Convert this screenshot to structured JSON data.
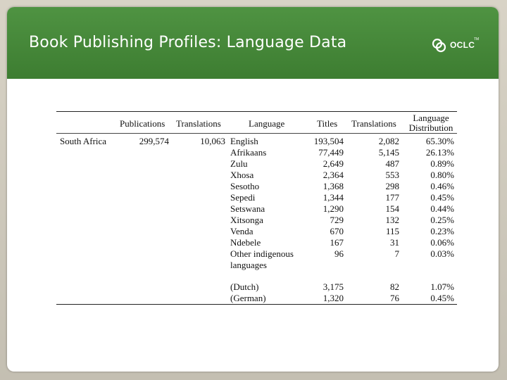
{
  "slide": {
    "title": "Book Publishing Profiles: Language Data",
    "logo": {
      "text": "OCLC",
      "tm": "TM",
      "icon": "oclc-circle-logo"
    }
  },
  "table": {
    "headers": {
      "publications": "Publications",
      "translations": "Translations",
      "language": "Language",
      "titles": "Titles",
      "lang_translations": "Translations",
      "distribution_line1": "Language",
      "distribution_line2": "Distribution"
    },
    "country": "South Africa",
    "publications": "299,574",
    "translations": "10,063",
    "rows": [
      {
        "language": "English",
        "titles": "193,504",
        "translations": "2,082",
        "distribution": "65.30%"
      },
      {
        "language": "Afrikaans",
        "titles": "77,449",
        "translations": "5,145",
        "distribution": "26.13%"
      },
      {
        "language": "Zulu",
        "titles": "2,649",
        "translations": "487",
        "distribution": "0.89%"
      },
      {
        "language": "Xhosa",
        "titles": "2,364",
        "translations": "553",
        "distribution": "0.80%"
      },
      {
        "language": "Sesotho",
        "titles": "1,368",
        "translations": "298",
        "distribution": "0.46%"
      },
      {
        "language": "Sepedi",
        "titles": "1,344",
        "translations": "177",
        "distribution": "0.45%"
      },
      {
        "language": "Setswana",
        "titles": "1,290",
        "translations": "154",
        "distribution": "0.44%"
      },
      {
        "language": "Xitsonga",
        "titles": "729",
        "translations": "132",
        "distribution": "0.25%"
      },
      {
        "language": "Venda",
        "titles": "670",
        "translations": "115",
        "distribution": "0.23%"
      },
      {
        "language": "Ndebele",
        "titles": "167",
        "translations": "31",
        "distribution": "0.06%"
      },
      {
        "language": "Other indigenous",
        "language_line2": "languages",
        "titles": "96",
        "translations": "7",
        "distribution": "0.03%"
      },
      {
        "language": "(Dutch)",
        "titles": "3,175",
        "translations": "82",
        "distribution": "1.07%"
      },
      {
        "language": "(German)",
        "titles": "1,320",
        "translations": "76",
        "distribution": "0.45%"
      }
    ]
  },
  "colors": {
    "header_green": "#468a3a",
    "frame": "#cfcabd",
    "text": "#111111"
  }
}
